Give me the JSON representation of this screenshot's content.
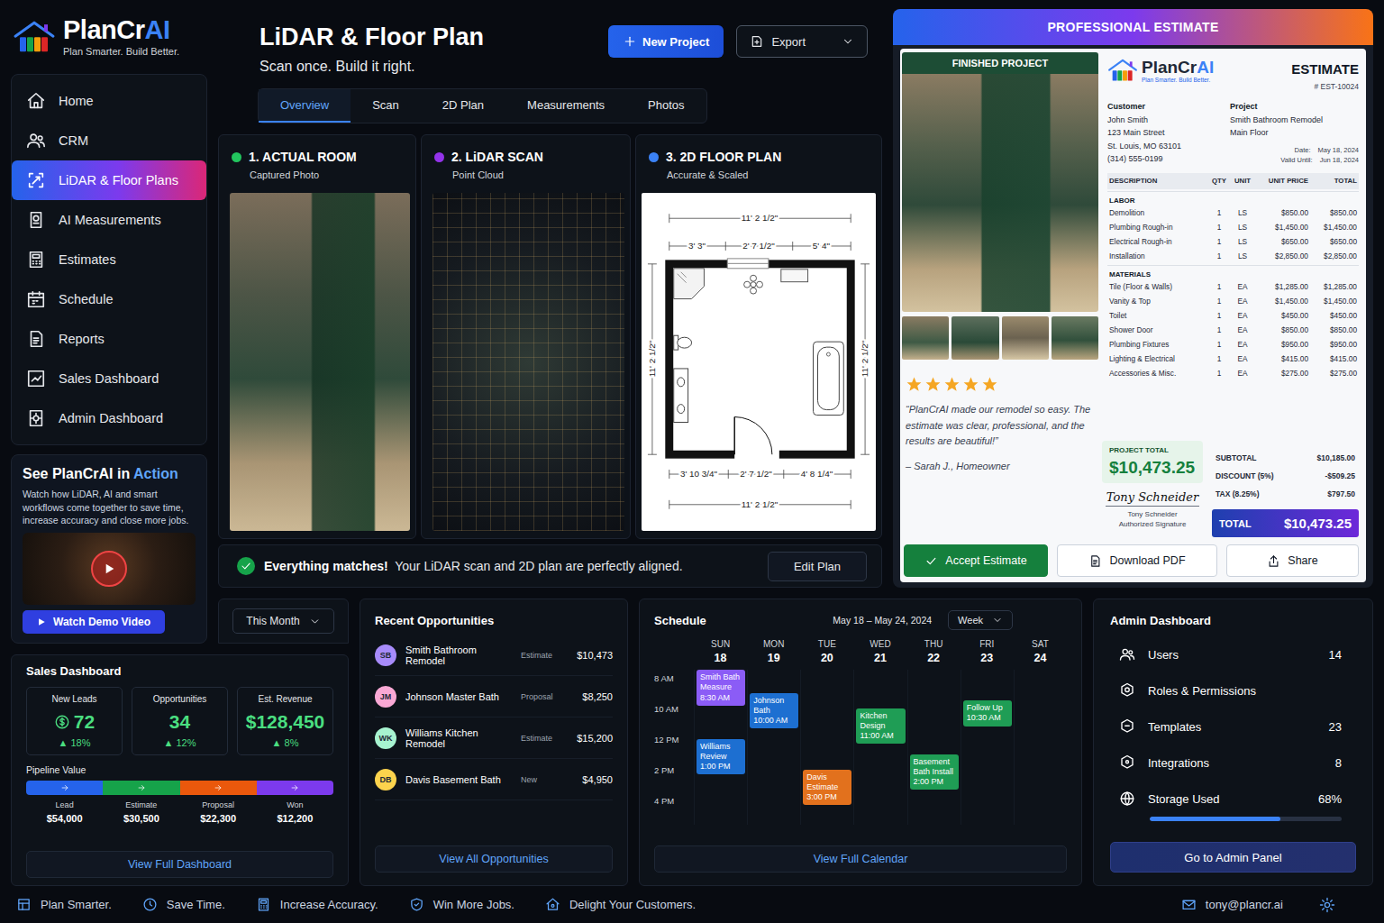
{
  "brand": {
    "name_a": "PlanCr",
    "name_b": "AI",
    "tagline": "Plan Smarter. Build Better."
  },
  "sidebar": {
    "items": [
      {
        "label": "Home",
        "kind": "home",
        "selected": false
      },
      {
        "label": "CRM",
        "kind": "users",
        "selected": false
      },
      {
        "label": "LiDAR & Floor Plans",
        "kind": "scan",
        "selected": true
      },
      {
        "label": "AI Measurements",
        "kind": "ruler",
        "selected": false
      },
      {
        "label": "Estimates",
        "kind": "calculator",
        "selected": false
      },
      {
        "label": "Schedule",
        "kind": "calendar",
        "selected": false
      },
      {
        "label": "Reports",
        "kind": "document",
        "selected": false
      },
      {
        "label": "Sales Dashboard",
        "kind": "chart",
        "selected": false
      },
      {
        "label": "Admin Dashboard",
        "kind": "settings",
        "selected": false
      }
    ]
  },
  "demo": {
    "title_a": "See PlanCrAI in ",
    "title_b": "Action",
    "text": "Watch how LiDAR, AI and smart workflows come together to save time, increase accuracy and close more jobs.",
    "button": "Watch Demo Video"
  },
  "header": {
    "title": "LiDAR & Floor Plan",
    "subtitle": "Scan once. Build it right.",
    "new_project": "New Project",
    "export": "Export"
  },
  "tabs": [
    {
      "label": "Overview",
      "selected": true
    },
    {
      "label": "Scan",
      "selected": false
    },
    {
      "label": "2D Plan",
      "selected": false
    },
    {
      "label": "Measurements",
      "selected": false
    },
    {
      "label": "Photos",
      "selected": false
    }
  ],
  "panels": [
    {
      "title": "1. ACTUAL ROOM",
      "subtitle": "Captured Photo",
      "color": "#22c55e",
      "kind": "photo"
    },
    {
      "title": "2. LiDAR SCAN",
      "subtitle": "Point Cloud",
      "color": "#9333ea",
      "kind": "scan"
    },
    {
      "title": "3. 2D FLOOR PLAN",
      "subtitle": "Accurate & Scaled",
      "color": "#3b82f6",
      "kind": "plan"
    }
  ],
  "floor_plan": {
    "top": "11' 2 1/2\"",
    "top_parts": [
      "3' 3\"",
      "2' 7 1/2\"",
      "5' 4\""
    ],
    "left": "11' 2 1/2\"",
    "right": "11' 2 1/2\"",
    "bottom_parts": [
      "3' 10 3/4\"",
      "2' 7 1/2\"",
      "4' 8 1/4\""
    ],
    "bottom": "11' 2 1/2\""
  },
  "match_banner": {
    "strong": "Everything matches!",
    "text": "Your LiDAR scan and 2D plan are perfectly aligned.",
    "button": "Edit Plan"
  },
  "estimate": {
    "header": "PROFESSIONAL ESTIMATE",
    "photo_label": "FINISHED PROJECT",
    "stars": 5,
    "testimonial": "“PlanCrAI made our remodel so easy. The estimate was clear, professional, and the results are beautiful!”",
    "testimonial_author": "– Sarah J., Homeowner",
    "project_total_label": "PROJECT TOTAL",
    "project_total": "$10,473.25",
    "logo_name_a": "PlanCr",
    "logo_name_b": "AI",
    "logo_tagline": "Plan Smarter. Build Better.",
    "title": "ESTIMATE",
    "number": "# EST-10024",
    "customer_label": "Customer",
    "customer_lines": [
      "John Smith",
      "123 Main Street",
      "St. Louis, MO 63101",
      "(314) 555-0199"
    ],
    "project_label": "Project",
    "project_lines": [
      "Smith Bathroom Remodel",
      "Main Floor"
    ],
    "date_label": "Date:",
    "date": "May 18, 2024",
    "valid_label": "Valid Until:",
    "valid": "Jun 18, 2024",
    "columns": [
      "DESCRIPTION",
      "QTY",
      "UNIT",
      "UNIT PRICE",
      "TOTAL"
    ],
    "sections": [
      {
        "title": "LABOR",
        "rows": [
          [
            "Demolition",
            "1",
            "LS",
            "$850.00",
            "$850.00"
          ],
          [
            "Plumbing Rough-in",
            "1",
            "LS",
            "$1,450.00",
            "$1,450.00"
          ],
          [
            "Electrical Rough-in",
            "1",
            "LS",
            "$650.00",
            "$650.00"
          ],
          [
            "Installation",
            "1",
            "LS",
            "$2,850.00",
            "$2,850.00"
          ]
        ]
      },
      {
        "title": "MATERIALS",
        "rows": [
          [
            "Tile (Floor & Walls)",
            "1",
            "EA",
            "$1,285.00",
            "$1,285.00"
          ],
          [
            "Vanity & Top",
            "1",
            "EA",
            "$1,450.00",
            "$1,450.00"
          ],
          [
            "Toilet",
            "1",
            "EA",
            "$450.00",
            "$450.00"
          ],
          [
            "Shower Door",
            "1",
            "EA",
            "$850.00",
            "$850.00"
          ],
          [
            "Plumbing Fixtures",
            "1",
            "EA",
            "$950.00",
            "$950.00"
          ],
          [
            "Lighting & Electrical",
            "1",
            "EA",
            "$415.00",
            "$415.00"
          ],
          [
            "Accessories & Misc.",
            "1",
            "EA",
            "$275.00",
            "$275.00"
          ]
        ]
      }
    ],
    "totals": [
      {
        "label": "SUBTOTAL",
        "value": "$10,185.00"
      },
      {
        "label": "DISCOUNT (5%)",
        "value": "-$509.25"
      },
      {
        "label": "TAX (8.25%)",
        "value": "$797.50"
      }
    ],
    "total_label": "TOTAL",
    "total": "$10,473.25",
    "signature": "Tony Schneider",
    "signer": "Tony Schneider",
    "signer_role": "Authorized Signature",
    "buttons": [
      {
        "label": "Accept Estimate",
        "kind": "check"
      },
      {
        "label": "Download PDF",
        "kind": "document"
      },
      {
        "label": "Share",
        "kind": "share"
      }
    ]
  },
  "sales": {
    "period": "This Month",
    "title": "Sales Dashboard",
    "stats": [
      {
        "label": "New Leads",
        "value": "72",
        "change": "▲ 18%",
        "kind": "leads"
      },
      {
        "label": "Opportunities",
        "value": "34",
        "change": "▲ 12%",
        "kind": "plain"
      },
      {
        "label": "Est. Revenue",
        "value": "$128,450",
        "change": "▲ 8%",
        "kind": "plain"
      }
    ],
    "pipeline_label": "Pipeline Value",
    "pipeline": [
      {
        "label": "Lead",
        "value": "$54,000",
        "color": "#2563eb"
      },
      {
        "label": "Estimate",
        "value": "$30,500",
        "color": "#16a34a"
      },
      {
        "label": "Proposal",
        "value": "$22,300",
        "color": "#ea580c"
      },
      {
        "label": "Won",
        "value": "$12,200",
        "color": "#7c3aed"
      }
    ],
    "link": "View Full Dashboard"
  },
  "opportunities": {
    "title": "Recent Opportunities",
    "items": [
      {
        "initials": "SB",
        "name": "Smith Bathroom Remodel",
        "stage": "Estimate",
        "amount": "$10,473",
        "color": "#a78bfa"
      },
      {
        "initials": "JM",
        "name": "Johnson Master Bath",
        "stage": "Proposal",
        "amount": "$8,250",
        "color": "#f9a8d4"
      },
      {
        "initials": "WK",
        "name": "Williams Kitchen Remodel",
        "stage": "Estimate",
        "amount": "$15,200",
        "color": "#a7f3d0"
      },
      {
        "initials": "DB",
        "name": "Davis Basement Bath",
        "stage": "New",
        "amount": "$4,950",
        "color": "#fcd34d"
      }
    ],
    "link": "View All Opportunities"
  },
  "schedule": {
    "title": "Schedule",
    "range": "May 18 – May 24, 2024",
    "view": "Week",
    "days": [
      {
        "name": "SUN",
        "date": "18"
      },
      {
        "name": "MON",
        "date": "19"
      },
      {
        "name": "TUE",
        "date": "20"
      },
      {
        "name": "WED",
        "date": "21"
      },
      {
        "name": "THU",
        "date": "22"
      },
      {
        "name": "FRI",
        "date": "23"
      },
      {
        "name": "SAT",
        "date": "24"
      }
    ],
    "hours": [
      "8 AM",
      "10 AM",
      "12 PM",
      "2 PM",
      "4 PM"
    ],
    "events": [
      {
        "title": "Smith Bath Measure",
        "time": "8:30 AM",
        "day": 0,
        "color": "#8b5cf6"
      },
      {
        "title": "Williams Review",
        "time": "1:00 PM",
        "day": 0,
        "color": "#1d6fd1"
      },
      {
        "title": "Johnson Bath",
        "time": "10:00 AM",
        "day": 1,
        "color": "#1d6fd1"
      },
      {
        "title": "Davis Estimate",
        "time": "3:00 PM",
        "day": 2,
        "color": "#e2711d"
      },
      {
        "title": "Kitchen Design",
        "time": "11:00 AM",
        "day": 3,
        "color": "#1f9d55"
      },
      {
        "title": "Basement Bath Install",
        "time": "2:00 PM",
        "day": 4,
        "color": "#1f9d55"
      },
      {
        "title": "Follow Up",
        "time": "10:30 AM",
        "day": 5,
        "color": "#1f9d55"
      }
    ],
    "link": "View Full Calendar"
  },
  "admin": {
    "title": "Admin Dashboard",
    "rows": [
      {
        "label": "Users",
        "value": "14",
        "kind": "users"
      },
      {
        "label": "Roles & Permissions",
        "value": "",
        "kind": "shield"
      },
      {
        "label": "Templates",
        "value": "23",
        "kind": "layers"
      },
      {
        "label": "Integrations",
        "value": "8",
        "kind": "plug"
      }
    ],
    "storage": {
      "label": "Storage Used",
      "value": "68%",
      "level": 0.68
    },
    "button": "Go to Admin Panel"
  },
  "footer": {
    "items": [
      {
        "label": "Plan Smarter.",
        "kind": "blueprint"
      },
      {
        "label": "Save Time.",
        "kind": "clock"
      },
      {
        "label": "Increase Accuracy.",
        "kind": "calculator"
      },
      {
        "label": "Win More Jobs.",
        "kind": "badge"
      },
      {
        "label": "Delight Your Customers.",
        "kind": "house"
      }
    ],
    "email": "tony@plancr.ai"
  }
}
